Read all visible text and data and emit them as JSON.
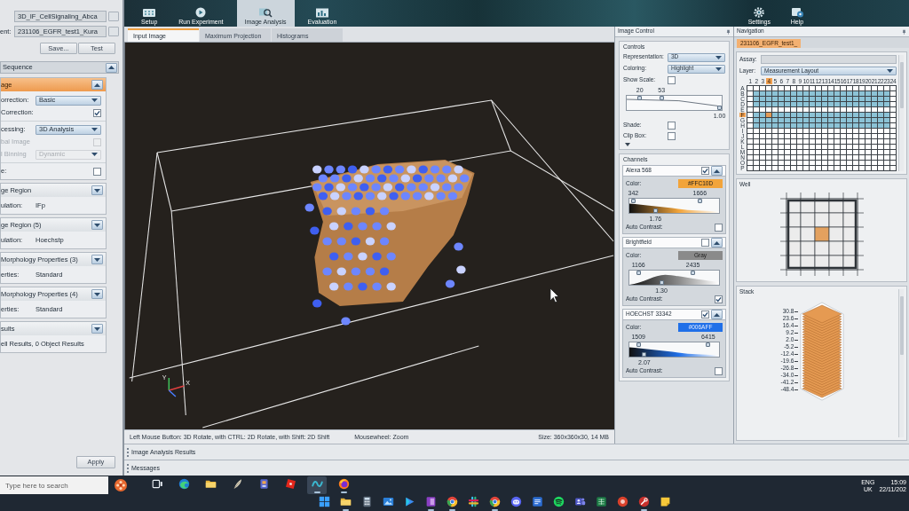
{
  "header": {
    "nav": [
      {
        "kind": "setup",
        "label": "Setup",
        "selected": false
      },
      {
        "kind": "run",
        "label": "Run Experiment",
        "selected": false
      },
      {
        "kind": "analysis",
        "label": "Image Analysis",
        "selected": true
      },
      {
        "kind": "evaluation",
        "label": "Evaluation",
        "selected": false
      }
    ],
    "tools": [
      {
        "kind": "settings",
        "label": "Settings"
      },
      {
        "kind": "help",
        "label": "Help"
      }
    ]
  },
  "analysis_panel": {
    "fields": [
      {
        "value": "3D_IF_CellSignaling_Abca"
      },
      {
        "label": "ent:",
        "value": "231106_EGFR_test1_Kura"
      }
    ],
    "buttons": [
      "Save...",
      "Test"
    ],
    "sequence": {
      "title": "Sequence",
      "expanded": true
    },
    "steps": [
      {
        "title": "age",
        "selected": true,
        "expanded": true,
        "groups": [
          {
            "rows": [
              {
                "kind": "dropdown",
                "label": "orrection:",
                "value": "Basic",
                "disabled": false
              },
              {
                "kind": "checkbox",
                "label": "Correction:",
                "checked": true,
                "disabled": false
              }
            ]
          },
          {
            "rows": [
              {
                "kind": "dropdown",
                "label": "cessing:",
                "value": "3D Analysis",
                "disabled": false
              },
              {
                "kind": "checkbox",
                "label": "bal Image",
                "checked": false,
                "disabled": true
              },
              {
                "kind": "dropdown",
                "label": "l Binning",
                "value": "Dynamic",
                "disabled": true
              }
            ]
          },
          {
            "rows": [
              {
                "kind": "checkbox",
                "label": "e:",
                "checked": false,
                "disabled": false
              }
            ]
          }
        ]
      },
      {
        "title": "ge Region",
        "selected": false,
        "expanded": false,
        "groups": [
          {
            "rows": [
              {
                "kind": "info",
                "label": "ulation:",
                "value": "IFp"
              }
            ]
          }
        ]
      },
      {
        "title": "ge Region (5)",
        "selected": false,
        "expanded": false,
        "groups": [
          {
            "rows": [
              {
                "kind": "info",
                "label": "ulation:",
                "value": "Hoechstp"
              }
            ]
          }
        ]
      },
      {
        "title": "Morphology Properties (3)",
        "selected": false,
        "expanded": false,
        "groups": [
          {
            "rows": [
              {
                "kind": "info",
                "label": "erties:",
                "value": "Standard"
              }
            ]
          }
        ]
      },
      {
        "title": "Morphology Properties (4)",
        "selected": false,
        "expanded": false,
        "groups": [
          {
            "rows": [
              {
                "kind": "info",
                "label": "erties:",
                "value": "Standard"
              }
            ]
          }
        ]
      },
      {
        "title": "sults",
        "selected": false,
        "expanded": false,
        "groups": [
          {
            "rows": [
              {
                "kind": "summary",
                "value": "ell Results, 0 Object Results"
              }
            ]
          }
        ]
      }
    ],
    "apply": "Apply"
  },
  "viewer": {
    "tabs": [
      {
        "label": "Input Image",
        "selected": true
      },
      {
        "label": "Maximum Projection",
        "selected": false
      },
      {
        "label": "Histograms",
        "selected": false
      }
    ],
    "axes": [
      {
        "label": "Y"
      },
      {
        "label": "X"
      }
    ],
    "hints": [
      "Left Mouse Button: 3D Rotate, with CTRL: 2D Rotate, with Shift: 2D Shift",
      "Mousewheel: Zoom"
    ],
    "size": "Size: 360x360x30, 14 MB"
  },
  "docked_panels": [
    {
      "title": "Image Analysis Results"
    },
    {
      "title": "Messages"
    }
  ],
  "image_control": {
    "title": "Image Control",
    "controls": {
      "title": "Controls",
      "rows": [
        {
          "kind": "dropdown",
          "label": "Representation:",
          "value": "3D"
        },
        {
          "kind": "dropdown",
          "label": "Coloring:",
          "value": "Highlight"
        },
        {
          "kind": "checkbox",
          "label": "Show Scale:",
          "checked": false
        },
        {
          "kind": "range",
          "thumbs": [
            {
              "kind": "upper",
              "label": "20",
              "level": 0.12
            },
            {
              "kind": "upper",
              "label": "53",
              "level": 0.36
            },
            {
              "kind": "lower",
              "label": "1.00",
              "level": 1
            }
          ]
        },
        {
          "kind": "checkbox",
          "label": "Shade:",
          "checked": false
        },
        {
          "kind": "checkbox",
          "label": "Clip Box:",
          "checked": false
        }
      ]
    },
    "channels": {
      "title": "Channels",
      "items": [
        {
          "kind": "fluorescence",
          "name": "Alexa 568",
          "visible": true,
          "expanded": true,
          "color_label": "Color:",
          "color_value": "#FFC10D",
          "color": "#f2a43a",
          "thumbs": [
            {
              "kind": "upper",
              "label": "342",
              "level": 0.02
            },
            {
              "kind": "upper",
              "label": "1666",
              "level": 0.8
            },
            {
              "kind": "lower",
              "label": "1.76",
              "level": 0.28
            }
          ],
          "auto_contrast": {
            "label": "Auto Contrast:",
            "checked": false
          }
        },
        {
          "kind": "brightfield",
          "name": "Brightfield",
          "visible": false,
          "expanded": true,
          "color_label": "Color:",
          "color_value": "Gray",
          "color": "#8a8a8a",
          "thumbs": [
            {
              "kind": "upper",
              "label": "1166",
              "level": 0.08
            },
            {
              "kind": "upper",
              "label": "2435",
              "level": 0.72
            },
            {
              "kind": "lower",
              "label": "1.30",
              "level": 0.35
            }
          ],
          "auto_contrast": {
            "label": "Auto Contrast:",
            "checked": true
          }
        },
        {
          "kind": "fluorescence",
          "name": "HOECHST 33342",
          "visible": true,
          "expanded": true,
          "color_label": "Color:",
          "color_value": "#006AFF",
          "color": "#1f6fe8",
          "thumbs": [
            {
              "kind": "upper",
              "label": "1509",
              "level": 0.08
            },
            {
              "kind": "upper",
              "label": "6415",
              "level": 0.9
            },
            {
              "kind": "lower",
              "label": "2.07",
              "level": 0.15
            }
          ],
          "auto_contrast": {
            "label": "Auto Contrast:",
            "checked": false
          }
        }
      ]
    }
  },
  "navigation": {
    "title": "Navigation",
    "tab": {
      "label": "231106_EGFR_test1_",
      "selected": true
    },
    "assay": {
      "label": "Assay:"
    },
    "layer": {
      "label": "Layer:",
      "value": "Measurement Layout"
    },
    "plate": {
      "columns": [
        {
          "label": "1",
          "selected": false
        },
        {
          "label": "2",
          "selected": false
        },
        {
          "label": "3",
          "selected": false
        },
        {
          "label": "4",
          "selected": true
        },
        {
          "label": "5",
          "selected": false
        },
        {
          "label": "6",
          "selected": false
        },
        {
          "label": "7",
          "selected": false
        },
        {
          "label": "8",
          "selected": false
        },
        {
          "label": "9",
          "selected": false
        },
        {
          "label": "10",
          "selected": false
        },
        {
          "label": "11",
          "selected": false
        },
        {
          "label": "12",
          "selected": false
        },
        {
          "label": "13",
          "selected": false
        },
        {
          "label": "14",
          "selected": false
        },
        {
          "label": "15",
          "selected": false
        },
        {
          "label": "16",
          "selected": false
        },
        {
          "label": "17",
          "selected": false
        },
        {
          "label": "18",
          "selected": false
        },
        {
          "label": "19",
          "selected": false
        },
        {
          "label": "20",
          "selected": false
        },
        {
          "label": "21",
          "selected": false
        },
        {
          "label": "22",
          "selected": false
        },
        {
          "label": "23",
          "selected": false
        },
        {
          "label": "24",
          "selected": false
        }
      ],
      "rows": [
        {
          "label": "A",
          "selected": false,
          "measured_wells": [
            false,
            false,
            false,
            false,
            false,
            false,
            false,
            false,
            false,
            false,
            false,
            false,
            false,
            false,
            false,
            false,
            false,
            false,
            false,
            false,
            false,
            false,
            false,
            false
          ]
        },
        {
          "label": "B",
          "selected": false,
          "measured_wells": [
            false,
            true,
            true,
            true,
            true,
            true,
            true,
            true,
            true,
            true,
            true,
            true,
            true,
            true,
            true,
            true,
            true,
            true,
            true,
            true,
            true,
            true,
            true,
            false
          ]
        },
        {
          "label": "C",
          "selected": false,
          "measured_wells": [
            false,
            true,
            true,
            true,
            true,
            true,
            true,
            true,
            true,
            true,
            true,
            true,
            true,
            true,
            true,
            true,
            true,
            true,
            true,
            true,
            true,
            true,
            true,
            false
          ]
        },
        {
          "label": "D",
          "selected": false,
          "measured_wells": [
            false,
            true,
            true,
            true,
            true,
            true,
            true,
            true,
            true,
            true,
            true,
            true,
            true,
            true,
            true,
            true,
            true,
            true,
            true,
            true,
            true,
            true,
            true,
            false
          ]
        },
        {
          "label": "E",
          "selected": false,
          "measured_wells": [
            false,
            false,
            false,
            false,
            false,
            false,
            false,
            false,
            false,
            false,
            false,
            false,
            false,
            false,
            false,
            false,
            false,
            false,
            false,
            false,
            false,
            false,
            false,
            false
          ]
        },
        {
          "label": "F",
          "selected": true,
          "measured_wells": [
            false,
            true,
            true,
            true,
            true,
            true,
            true,
            true,
            true,
            true,
            true,
            true,
            true,
            true,
            true,
            true,
            true,
            true,
            true,
            true,
            true,
            true,
            true,
            false
          ]
        },
        {
          "label": "G",
          "selected": false,
          "measured_wells": [
            false,
            true,
            true,
            true,
            true,
            true,
            true,
            true,
            true,
            true,
            true,
            true,
            true,
            true,
            true,
            true,
            true,
            true,
            true,
            true,
            true,
            true,
            true,
            false
          ]
        },
        {
          "label": "H",
          "selected": false,
          "measured_wells": [
            false,
            true,
            true,
            true,
            true,
            true,
            true,
            true,
            true,
            true,
            true,
            true,
            true,
            true,
            true,
            true,
            true,
            true,
            true,
            true,
            true,
            true,
            true,
            false
          ]
        },
        {
          "label": "I",
          "selected": false,
          "measured_wells": [
            false,
            false,
            false,
            false,
            false,
            false,
            false,
            false,
            false,
            false,
            false,
            false,
            false,
            false,
            false,
            false,
            false,
            false,
            false,
            false,
            false,
            false,
            false,
            false
          ]
        },
        {
          "label": "J",
          "selected": false,
          "measured_wells": [
            false,
            false,
            false,
            false,
            false,
            false,
            false,
            false,
            false,
            false,
            false,
            false,
            false,
            false,
            false,
            false,
            false,
            false,
            false,
            false,
            false,
            false,
            false,
            false
          ]
        },
        {
          "label": "K",
          "selected": false,
          "measured_wells": [
            false,
            false,
            false,
            false,
            false,
            false,
            false,
            false,
            false,
            false,
            false,
            false,
            false,
            false,
            false,
            false,
            false,
            false,
            false,
            false,
            false,
            false,
            false,
            false
          ]
        },
        {
          "label": "L",
          "selected": false,
          "measured_wells": [
            false,
            false,
            false,
            false,
            false,
            false,
            false,
            false,
            false,
            false,
            false,
            false,
            false,
            false,
            false,
            false,
            false,
            false,
            false,
            false,
            false,
            false,
            false,
            false
          ]
        },
        {
          "label": "M",
          "selected": false,
          "measured_wells": [
            false,
            false,
            false,
            false,
            false,
            false,
            false,
            false,
            false,
            false,
            false,
            false,
            false,
            false,
            false,
            false,
            false,
            false,
            false,
            false,
            false,
            false,
            false,
            false
          ]
        },
        {
          "label": "N",
          "selected": false,
          "measured_wells": [
            false,
            false,
            false,
            false,
            false,
            false,
            false,
            false,
            false,
            false,
            false,
            false,
            false,
            false,
            false,
            false,
            false,
            false,
            false,
            false,
            false,
            false,
            false,
            false
          ]
        },
        {
          "label": "O",
          "selected": false,
          "measured_wells": [
            false,
            false,
            false,
            false,
            false,
            false,
            false,
            false,
            false,
            false,
            false,
            false,
            false,
            false,
            false,
            false,
            false,
            false,
            false,
            false,
            false,
            false,
            false,
            false
          ]
        },
        {
          "label": "P",
          "selected": false,
          "measured_wells": [
            false,
            false,
            false,
            false,
            false,
            false,
            false,
            false,
            false,
            false,
            false,
            false,
            false,
            false,
            false,
            false,
            false,
            false,
            false,
            false,
            false,
            false,
            false,
            false
          ]
        }
      ]
    },
    "well": {
      "title": "Well",
      "field_rows": [
        {
          "fields": [
            {
              "selected": false
            },
            {
              "selected": false
            },
            {
              "selected": false
            },
            {
              "selected": false
            },
            {
              "selected": false
            }
          ]
        },
        {
          "fields": [
            {
              "selected": false
            },
            {
              "selected": false
            },
            {
              "selected": false
            },
            {
              "selected": false
            },
            {
              "selected": false
            }
          ]
        },
        {
          "fields": [
            {
              "selected": false
            },
            {
              "selected": false
            },
            {
              "selected": true
            },
            {
              "selected": false
            },
            {
              "selected": false
            }
          ]
        },
        {
          "fields": [
            {
              "selected": false
            },
            {
              "selected": false
            },
            {
              "selected": false
            },
            {
              "selected": false
            },
            {
              "selected": false
            }
          ]
        },
        {
          "fields": [
            {
              "selected": false
            },
            {
              "selected": false
            },
            {
              "selected": false
            },
            {
              "selected": false
            },
            {
              "selected": false
            }
          ]
        }
      ]
    },
    "stack": {
      "title": "Stack",
      "ticks": [
        "30.8",
        "23.6",
        "16.4",
        "9.2",
        "2.0",
        "-5.2",
        "-12.4",
        "-19.6",
        "-26.8",
        "-34.0",
        "-41.2",
        "-48.4"
      ]
    }
  },
  "taskbar": {
    "search": {
      "placeholder": "Type here to search"
    },
    "pinned": [
      {
        "kind": "taskview",
        "running": false,
        "active": false
      },
      {
        "kind": "edge",
        "running": false,
        "active": false
      },
      {
        "kind": "folder",
        "running": false,
        "active": false
      },
      {
        "kind": "feather",
        "running": false,
        "active": false
      },
      {
        "kind": "tower",
        "running": false,
        "active": false
      },
      {
        "kind": "cube",
        "running": false,
        "active": false
      },
      {
        "kind": "wave",
        "running": true,
        "active": true
      },
      {
        "kind": "firefox",
        "running": true,
        "active": false
      }
    ],
    "centered": [
      {
        "kind": "start",
        "running": false
      },
      {
        "kind": "folder",
        "running": true
      },
      {
        "kind": "calculator",
        "running": false
      },
      {
        "kind": "photos",
        "running": false
      },
      {
        "kind": "video",
        "running": false
      },
      {
        "kind": "notebook",
        "running": true
      },
      {
        "kind": "chrome",
        "running": true
      },
      {
        "kind": "slack",
        "running": false
      },
      {
        "kind": "chrome",
        "running": true
      },
      {
        "kind": "chat",
        "running": false
      },
      {
        "kind": "doc",
        "running": false
      },
      {
        "kind": "music",
        "running": false
      },
      {
        "kind": "team",
        "running": false
      },
      {
        "kind": "sheet",
        "running": false
      },
      {
        "kind": "record",
        "running": false
      },
      {
        "kind": "tool",
        "running": true
      },
      {
        "kind": "note",
        "running": false
      }
    ],
    "tray": {
      "language": "ENG",
      "region": "UK",
      "time": "15:09",
      "date": "22/11/202"
    }
  }
}
